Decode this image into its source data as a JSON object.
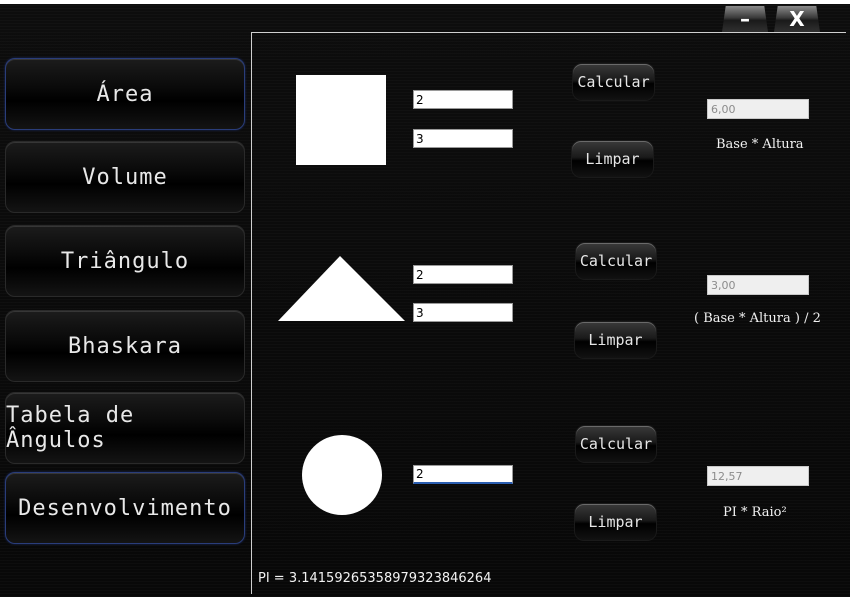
{
  "window": {
    "minimize_label": "–",
    "close_label": "X"
  },
  "sidebar": {
    "items": [
      {
        "label": "Área"
      },
      {
        "label": "Volume"
      },
      {
        "label": "Triângulo"
      },
      {
        "label": "Bhaskara"
      },
      {
        "label": "Tabela de Ângulos"
      },
      {
        "label": "Desenvolvimento"
      }
    ]
  },
  "square": {
    "input1": "2",
    "input2": "3",
    "calc_label": "Calcular",
    "clear_label": "Limpar",
    "result": "6,00",
    "formula": "Base * Altura"
  },
  "triangle": {
    "input1": "2",
    "input2": "3",
    "calc_label": "Calcular",
    "clear_label": "Limpar",
    "result": "3,00",
    "formula": "( Base * Altura ) / 2"
  },
  "circle": {
    "input1": "2",
    "calc_label": "Calcular",
    "clear_label": "Limpar",
    "result": "12,57",
    "formula": "PI * Raio²"
  },
  "footer": {
    "pi_text": "PI = 3.14159265358979323846264"
  },
  "colors": {
    "background": "#050505",
    "active_border": "#2a3d7a",
    "shape_fill": "#ffffff"
  }
}
